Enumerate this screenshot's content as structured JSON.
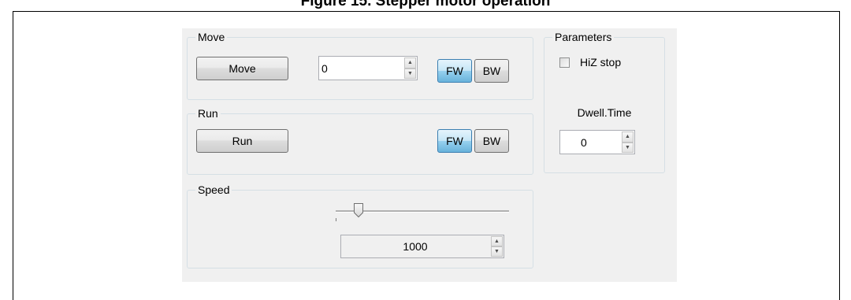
{
  "figure": {
    "caption": "Figure 15. Stepper motor operation"
  },
  "move": {
    "title": "Move",
    "button_label": "Move",
    "steps_value": "0",
    "fw_label": "FW",
    "bw_label": "BW"
  },
  "run": {
    "title": "Run",
    "button_label": "Run",
    "fw_label": "FW",
    "bw_label": "BW"
  },
  "speed": {
    "title": "Speed",
    "slider_level": 0.12,
    "value": "1000"
  },
  "parameters": {
    "title": "Parameters",
    "hiz_label": "HiZ stop",
    "hiz_checked": false,
    "dwell_label": "Dwell.Time",
    "dwell_value": "0"
  },
  "colors": {
    "panel_bg": "#f0f0f0",
    "toggle_active": "#68b3db",
    "group_border": "#d5dfe5"
  },
  "icons": [
    "spin-up-arrow-icon",
    "spin-down-arrow-icon",
    "slider-thumb-icon",
    "checkbox-icon"
  ]
}
